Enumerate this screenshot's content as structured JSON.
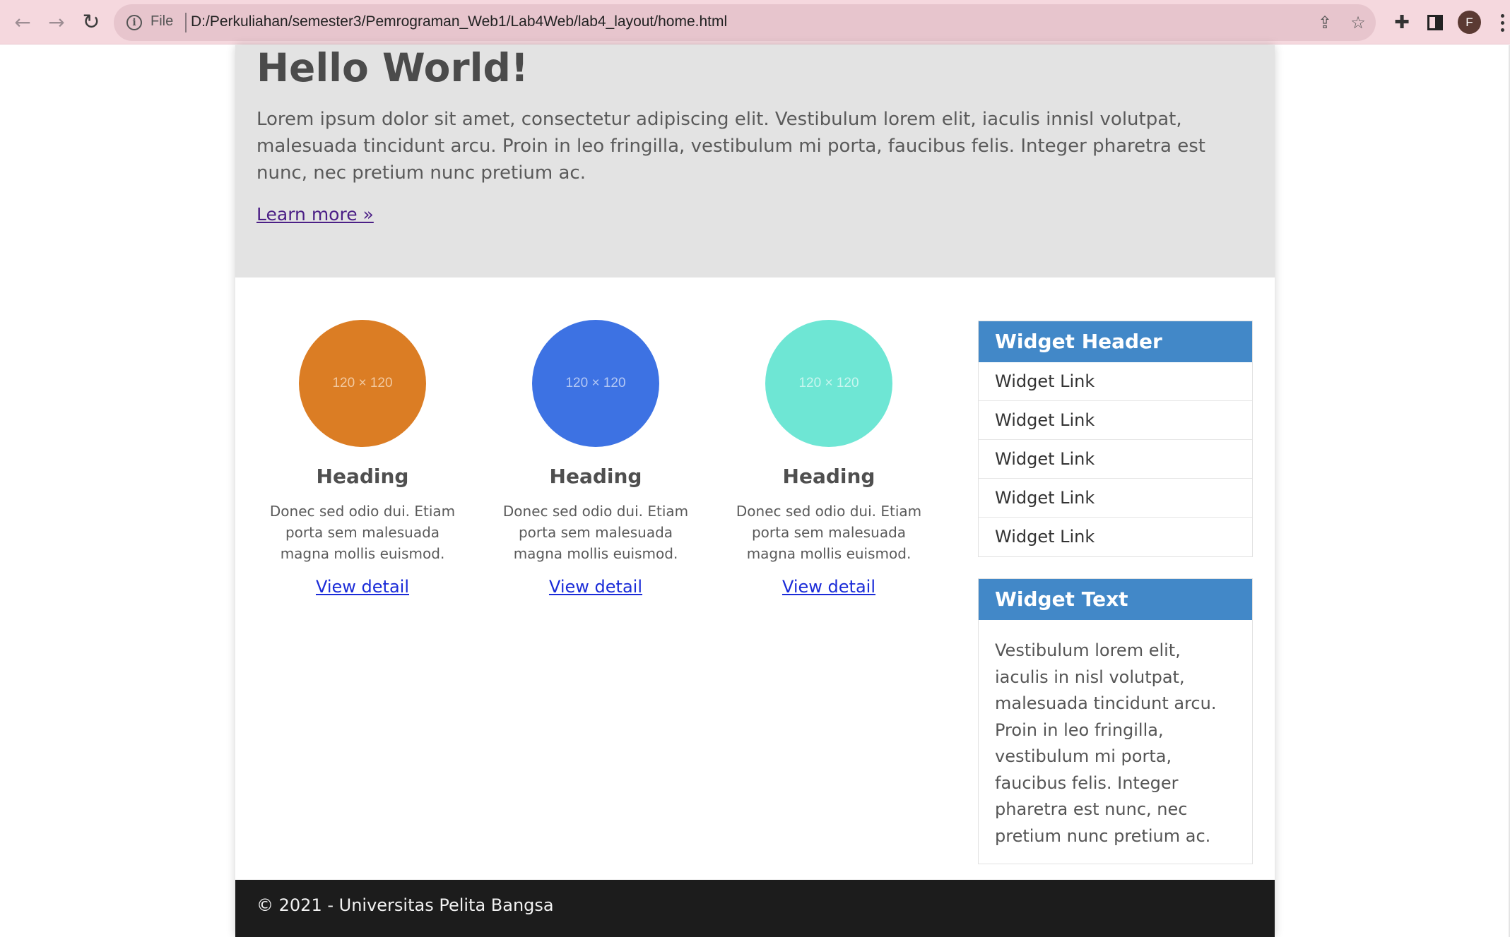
{
  "browser": {
    "file_label": "File",
    "url": "D:/Perkuliahan/semester3/Pemrograman_Web1/Lab4Web/lab4_layout/home.html",
    "profile_initial": "F"
  },
  "hero": {
    "title": "Hello World!",
    "text": "Lorem ipsum dolor sit amet, consectetur adipiscing elit. Vestibulum lorem elit, iaculis innisl volutpat, malesuada tincidunt arcu. Proin in leo fringilla, vestibulum mi porta, faucibus felis. Integer pharetra est nunc, nec pretium nunc pretium ac.",
    "link": "Learn more »"
  },
  "cards": [
    {
      "image_label": "120 × 120",
      "color": "#db7d24",
      "label_color": "#f2c9a0",
      "heading": "Heading",
      "text": "Donec sed odio dui. Etiam porta sem malesuada magna mollis euismod.",
      "link": "View detail"
    },
    {
      "image_label": "120 × 120",
      "color": "#3d72e3",
      "label_color": "#b4c8f4",
      "heading": "Heading",
      "text": "Donec sed odio dui. Etiam porta sem malesuada magna mollis euismod.",
      "link": "View detail"
    },
    {
      "image_label": "120 × 120",
      "color": "#6ee6d4",
      "label_color": "#c8f6ef",
      "heading": "Heading",
      "text": "Donec sed odio dui. Etiam porta sem malesuada magna mollis euismod.",
      "link": "View detail"
    }
  ],
  "widget_links": {
    "header": "Widget Header",
    "links": [
      "Widget Link",
      "Widget Link",
      "Widget Link",
      "Widget Link",
      "Widget Link"
    ]
  },
  "widget_text": {
    "header": "Widget Text",
    "text": "Vestibulum lorem elit, iaculis in nisl volutpat, malesuada tincidunt arcu. Proin in leo fringilla, vestibulum mi porta, faucibus felis. Integer pharetra est nunc, nec pretium nunc pretium ac."
  },
  "footer": {
    "text": "© 2021 - Universitas Pelita Bangsa"
  },
  "colors": {
    "widget_header": "#4288c8",
    "hero_bg": "#e3e3e3",
    "footer_bg": "#1c1c1c",
    "link": "#1a2bd8"
  }
}
